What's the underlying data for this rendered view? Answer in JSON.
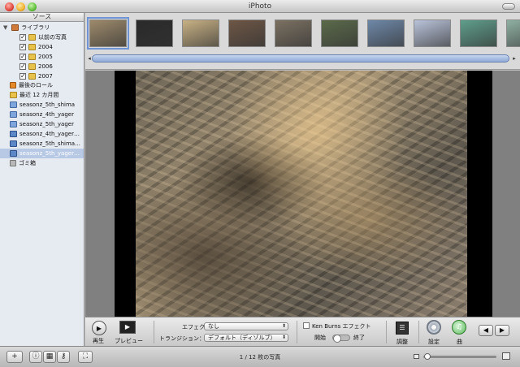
{
  "window": {
    "title": "iPhoto"
  },
  "sidebar": {
    "header": "ソース",
    "library": {
      "label": "ライブラリ",
      "icon": "library-icon"
    },
    "library_children": [
      {
        "label": "以前の写真",
        "checked": true
      },
      {
        "label": "2004",
        "checked": true
      },
      {
        "label": "2005",
        "checked": true
      },
      {
        "label": "2006",
        "checked": true
      },
      {
        "label": "2007",
        "checked": true
      }
    ],
    "items": [
      {
        "label": "最後のロール",
        "icon": "roll-icon"
      },
      {
        "label": "最近 12 カ月間",
        "icon": "folder-icon"
      },
      {
        "label": "seasonz_5th_shima",
        "icon": "album-icon"
      },
      {
        "label": "seasonz_4th_yager",
        "icon": "album-icon"
      },
      {
        "label": "seasonz_5th_yager",
        "icon": "album-icon"
      },
      {
        "label": "seasonz_4th_yager…",
        "icon": "slideshow-icon"
      },
      {
        "label": "seasonz_5th_shima…",
        "icon": "slideshow-icon"
      },
      {
        "label": "seasonz_5th_yager…",
        "icon": "slideshow-icon",
        "selected": true
      },
      {
        "label": "ゴミ箱",
        "icon": "trash-icon"
      }
    ]
  },
  "filmstrip": {
    "thumbnails": [
      {
        "name": "thumb-1",
        "color": "#9d8a6b",
        "selected": true
      },
      {
        "name": "thumb-2",
        "color": "#2a2a2a"
      },
      {
        "name": "thumb-3",
        "color": "#c8b184"
      },
      {
        "name": "thumb-4",
        "color": "#6d5645"
      },
      {
        "name": "thumb-5",
        "color": "#7b7162"
      },
      {
        "name": "thumb-6",
        "color": "#5b6a4a"
      },
      {
        "name": "thumb-7",
        "color": "#6e88a8"
      },
      {
        "name": "thumb-8",
        "color": "#b9c3da"
      },
      {
        "name": "thumb-9",
        "color": "#5f9e8b"
      },
      {
        "name": "thumb-10",
        "color": "#8fb0a3"
      }
    ]
  },
  "toolbar": {
    "play_label": "再生",
    "preview_label": "プレビュー",
    "effect_label": "エフェクト：",
    "effect_value": "なし",
    "transition_label": "トランジション：",
    "transition_value": "デフォルト（ディゾルブ）",
    "kenburns_label": "Ken Burns エフェクト",
    "start_label": "開始",
    "end_label": "終了",
    "adjust_label": "調整",
    "settings_label": "設定",
    "music_label": "曲"
  },
  "bottom": {
    "photo_count": "1 / 12 枚の写真"
  }
}
